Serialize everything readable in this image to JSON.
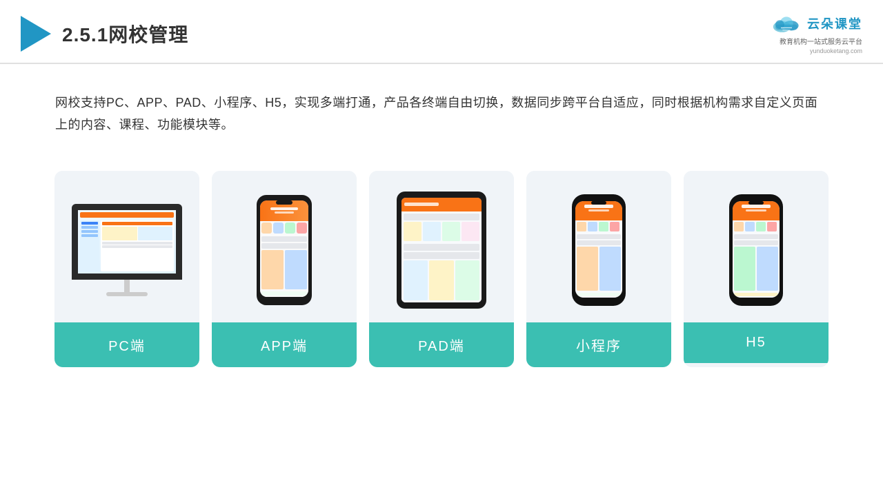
{
  "header": {
    "title": "2.5.1网校管理",
    "brand_name": "云朵课堂",
    "brand_tagline": "教育机构一站式服务云平台",
    "brand_url": "yunduoketang.com"
  },
  "description": {
    "text": "网校支持PC、APP、PAD、小程序、H5，实现多端打通，产品各终端自由切换，数据同步跨平台自适应，同时根据机构需求自定义页面上的内容、课程、功能模块等。"
  },
  "cards": [
    {
      "id": "pc",
      "label": "PC端"
    },
    {
      "id": "app",
      "label": "APP端"
    },
    {
      "id": "pad",
      "label": "PAD端"
    },
    {
      "id": "miniapp",
      "label": "小程序"
    },
    {
      "id": "h5",
      "label": "H5"
    }
  ],
  "colors": {
    "primary": "#3bbfb2",
    "accent": "#f97316",
    "header_line": "#e0e0e0",
    "logo_blue": "#2196c4",
    "card_bg": "#f0f4f8"
  }
}
